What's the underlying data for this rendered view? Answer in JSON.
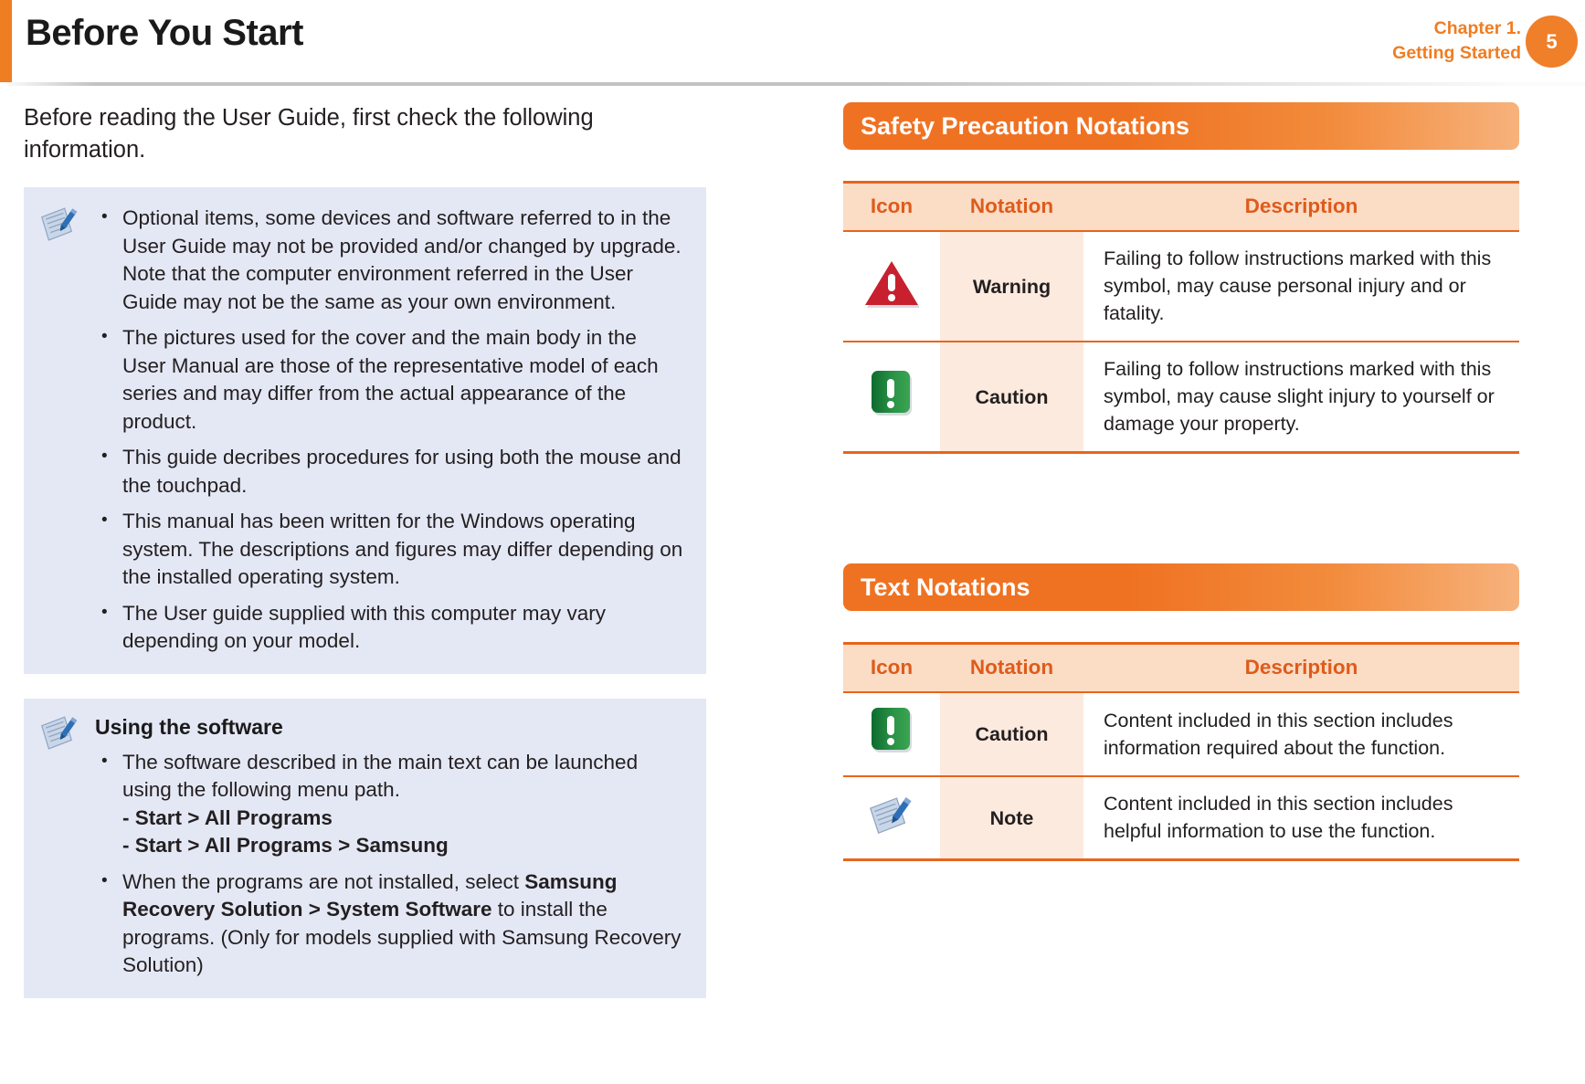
{
  "header": {
    "title": "Before You Start",
    "chapter_line1": "Chapter 1.",
    "chapter_line2": "Getting Started",
    "page_number": "5",
    "accent_color": "#ef7d22"
  },
  "left_column": {
    "intro": "Before reading the User Guide, first check the following information.",
    "note_box_1": {
      "icon": "note-icon",
      "bullets": [
        "Optional items, some devices and software referred to in the User Guide may not be provided and/or changed by upgrade.\nNote that the computer environment referred in the User Guide may not be the same as your own environment.",
        "The pictures used for the cover and the main body in the User Manual are those of the representative model of each series and may differ from the actual appearance of the product.",
        "This guide decribes procedures for using both the mouse and the touchpad.",
        "This manual has been written for the Windows operating system. The descriptions and figures may differ depending on the installed operating system.",
        "The User guide supplied with this computer may vary depending on your model."
      ]
    },
    "note_box_2": {
      "icon": "note-icon",
      "subtitle": "Using the software",
      "bullet_1_text": "The software described in the main text can be launched using the following menu path.",
      "bullet_1_path_1": "- Start > All Programs",
      "bullet_1_path_2": "- Start > All Programs > Samsung",
      "bullet_2_part1": "When the programs are not installed, select ",
      "bullet_2_bold1": "Samsung Recovery Solution > System Software",
      "bullet_2_part2": " to install the programs. (Only for models supplied with Samsung Recovery Solution)"
    }
  },
  "right_column": {
    "section_1": {
      "heading": "Safety Precaution Notations",
      "table": {
        "columns": [
          "Icon",
          "Notation",
          "Description"
        ],
        "rows": [
          {
            "icon": "warning-triangle-icon",
            "notation": "Warning",
            "description": "Failing to follow instructions marked with this symbol, may cause personal injury and or fatality."
          },
          {
            "icon": "caution-square-icon",
            "notation": "Caution",
            "description": "Failing to follow instructions marked with this symbol, may cause slight injury to yourself or damage your property."
          }
        ]
      }
    },
    "section_2": {
      "heading": "Text Notations",
      "table": {
        "columns": [
          "Icon",
          "Notation",
          "Description"
        ],
        "rows": [
          {
            "icon": "caution-square-icon",
            "notation": "Caution",
            "description": "Content included in this section includes information required about the function."
          },
          {
            "icon": "note-icon",
            "notation": "Note",
            "description": "Content included in this section includes helpful information to use the function."
          }
        ]
      }
    }
  },
  "colors": {
    "orange": "#ef7222",
    "orange_dark": "#de5b1c",
    "note_box_bg": "#e4e8f5",
    "table_header_bg": "#fbdcc4",
    "notation_cell_bg": "#fdeade",
    "warning_red": "#c8202e",
    "caution_green": "#1f8a3b"
  }
}
